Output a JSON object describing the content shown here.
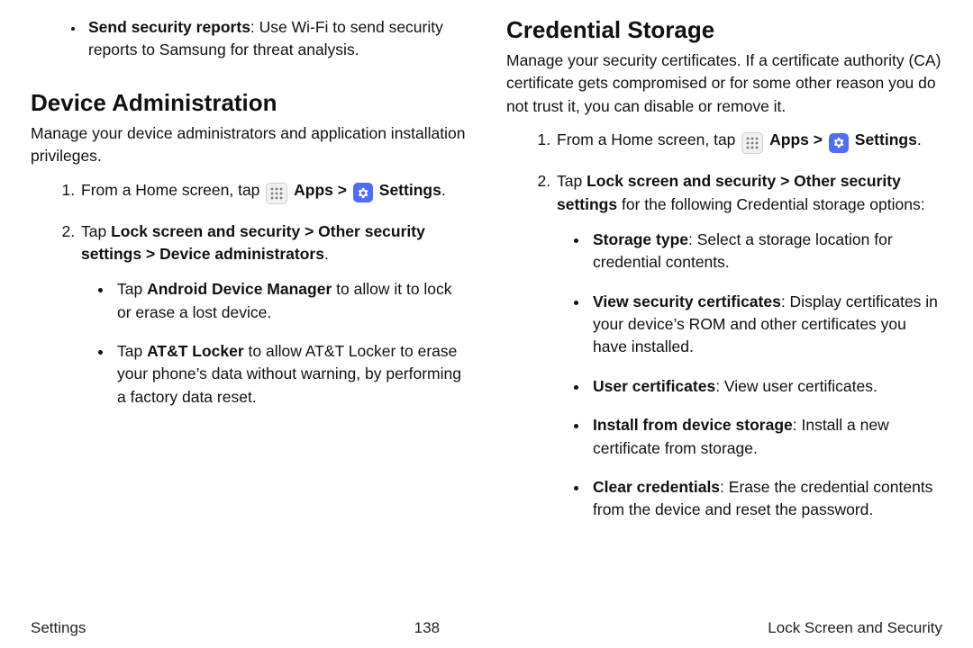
{
  "footer": {
    "left": "Settings",
    "center": "138",
    "right": "Lock Screen and Security"
  },
  "left": {
    "bullet_lead": "Send security reports",
    "bullet_tail": ": Use Wi-Fi to send security reports to Samsung for threat analysis.",
    "heading": "Device Administration",
    "intro": "Manage your device administrators and application installation privileges.",
    "step1_pre": "From a Home screen, tap ",
    "apps_label": "Apps",
    "settings_label": "Settings",
    "step2_a": "Tap ",
    "step2_b": "Lock screen and security",
    "step2_c": "Other security settings",
    "step2_d": "Device administrators",
    "sub1_a": "Tap ",
    "sub1_b": "Android Device Manager",
    "sub1_c": " to allow it to lock or erase a lost device.",
    "sub2_a": "Tap ",
    "sub2_b": "AT&T Locker",
    "sub2_c": " to allow AT&T Locker to erase your phone’s data without warning, by performing a factory data reset."
  },
  "right": {
    "heading": "Credential Storage",
    "intro": "Manage your security certificates. If a certificate authority (CA) certificate gets compromised or for some other reason you do not trust it, you can disable or remove it.",
    "step1_pre": "From a Home screen, tap ",
    "apps_label": "Apps",
    "settings_label": "Settings",
    "step2_a": "Tap ",
    "step2_b": "Lock screen and security",
    "step2_c": "Other security settings",
    "step2_d": " for the following Credential storage options:",
    "opts": {
      "o1a": "Storage type",
      "o1b": ": Select a storage location for credential contents.",
      "o2a": "View security certificates",
      "o2b": ": Display certificates in your device’s ROM and other certificates you have installed.",
      "o3a": "User certificates",
      "o3b": ": View user certificates.",
      "o4a": "Install from device storage",
      "o4b": ": Install a new certificate from storage.",
      "o5a": "Clear credentials",
      "o5b": ": Erase the credential contents from the device and reset the password."
    }
  },
  "chevron": ">",
  "period": "."
}
